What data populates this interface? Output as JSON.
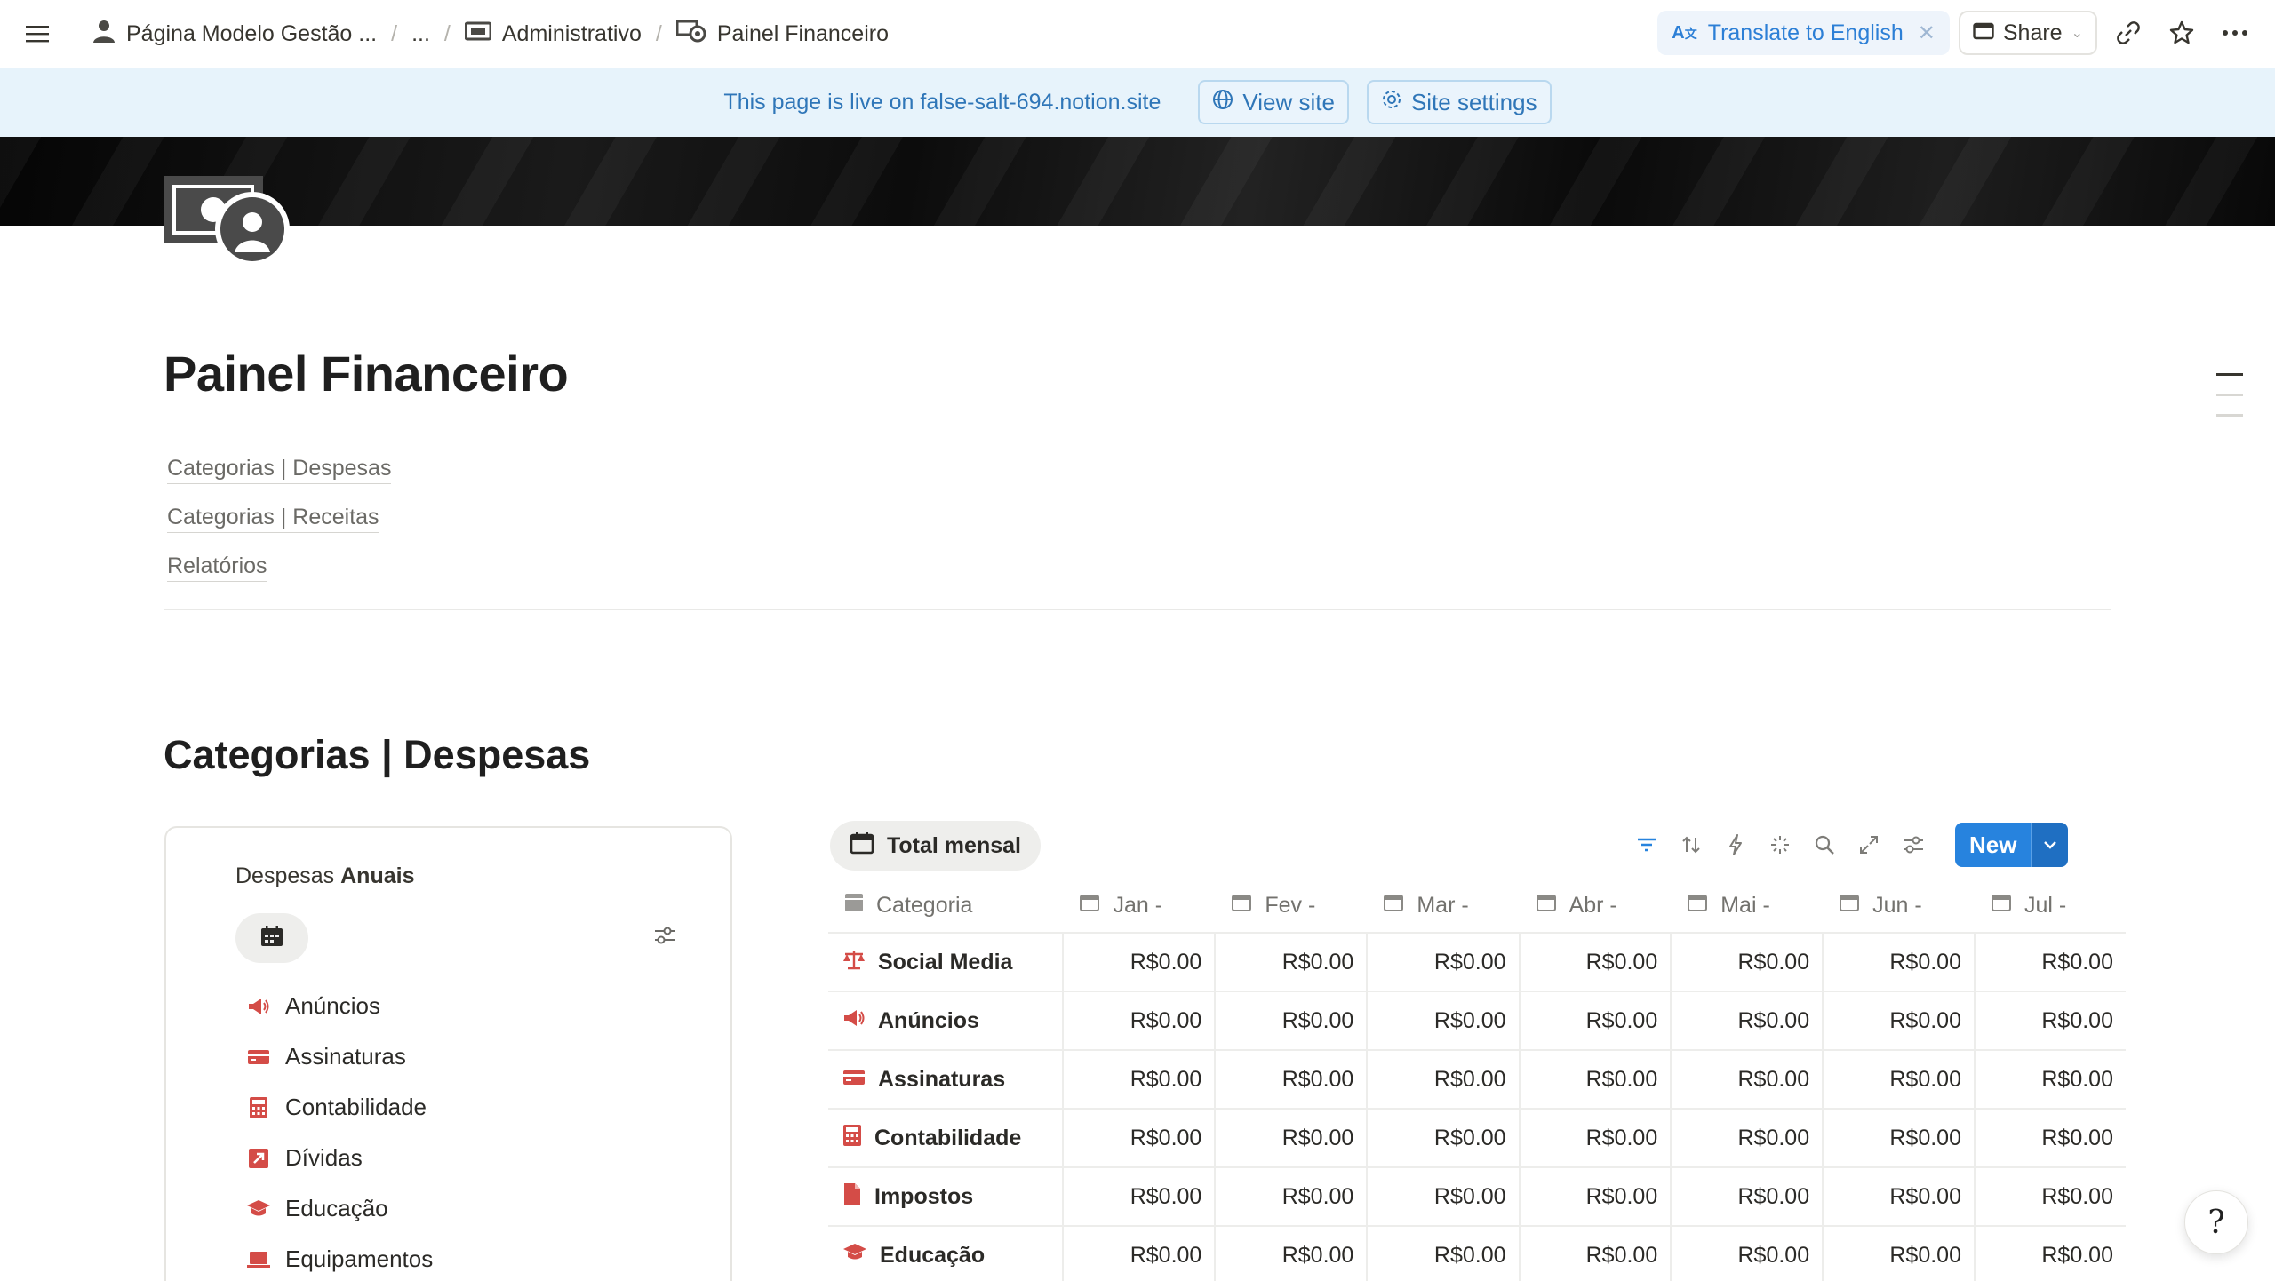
{
  "breadcrumb": {
    "workspace": "Página Modelo Gestão ...",
    "ellipsis": "...",
    "parent": "Administrativo",
    "current": "Painel Financeiro"
  },
  "topbar": {
    "translate_label": "Translate to English",
    "share_label": "Share"
  },
  "banner": {
    "message": "This page is live on false-salt-694.notion.site",
    "view_site": "View site",
    "site_settings": "Site settings"
  },
  "page": {
    "title": "Painel Financeiro",
    "toc": [
      "Categorias | Despesas",
      "Categorias | Receitas",
      "Relatórios"
    ],
    "section_heading": "Categorias | Despesas"
  },
  "card": {
    "title_prefix": "Despesas",
    "title_bold": "Anuais",
    "items": [
      {
        "label": "Anúncios",
        "icon": "megaphone-icon"
      },
      {
        "label": "Assinaturas",
        "icon": "credit-card-icon"
      },
      {
        "label": "Contabilidade",
        "icon": "calculator-icon"
      },
      {
        "label": "Dívidas",
        "icon": "arrow-up-right-icon"
      },
      {
        "label": "Educação",
        "icon": "graduation-cap-icon"
      },
      {
        "label": "Equipamentos",
        "icon": "laptop-icon"
      }
    ]
  },
  "table_view": {
    "tab_label": "Total mensal",
    "new_label": "New",
    "columns": [
      "Categoria",
      "Jan -",
      "Fev -",
      "Mar -",
      "Abr -",
      "Mai -",
      "Jun -",
      "Jul -"
    ],
    "rows": [
      {
        "category": "Social Media",
        "icon": "scale-icon",
        "values": [
          "R$0.00",
          "R$0.00",
          "R$0.00",
          "R$0.00",
          "R$0.00",
          "R$0.00",
          "R$0.00"
        ]
      },
      {
        "category": "Anúncios",
        "icon": "megaphone-icon",
        "values": [
          "R$0.00",
          "R$0.00",
          "R$0.00",
          "R$0.00",
          "R$0.00",
          "R$0.00",
          "R$0.00"
        ]
      },
      {
        "category": "Assinaturas",
        "icon": "credit-card-icon",
        "values": [
          "R$0.00",
          "R$0.00",
          "R$0.00",
          "R$0.00",
          "R$0.00",
          "R$0.00",
          "R$0.00"
        ]
      },
      {
        "category": "Contabilidade",
        "icon": "calculator-icon",
        "values": [
          "R$0.00",
          "R$0.00",
          "R$0.00",
          "R$0.00",
          "R$0.00",
          "R$0.00",
          "R$0.00"
        ]
      },
      {
        "category": "Impostos",
        "icon": "document-icon",
        "values": [
          "R$0.00",
          "R$0.00",
          "R$0.00",
          "R$0.00",
          "R$0.00",
          "R$0.00",
          "R$0.00"
        ]
      },
      {
        "category": "Educação",
        "icon": "graduation-cap-icon",
        "values": [
          "R$0.00",
          "R$0.00",
          "R$0.00",
          "R$0.00",
          "R$0.00",
          "R$0.00",
          "R$0.00"
        ]
      }
    ]
  },
  "colors": {
    "accent_blue": "#2783de",
    "icon_red": "#d44c47",
    "banner_bg": "#e7f3fb"
  }
}
